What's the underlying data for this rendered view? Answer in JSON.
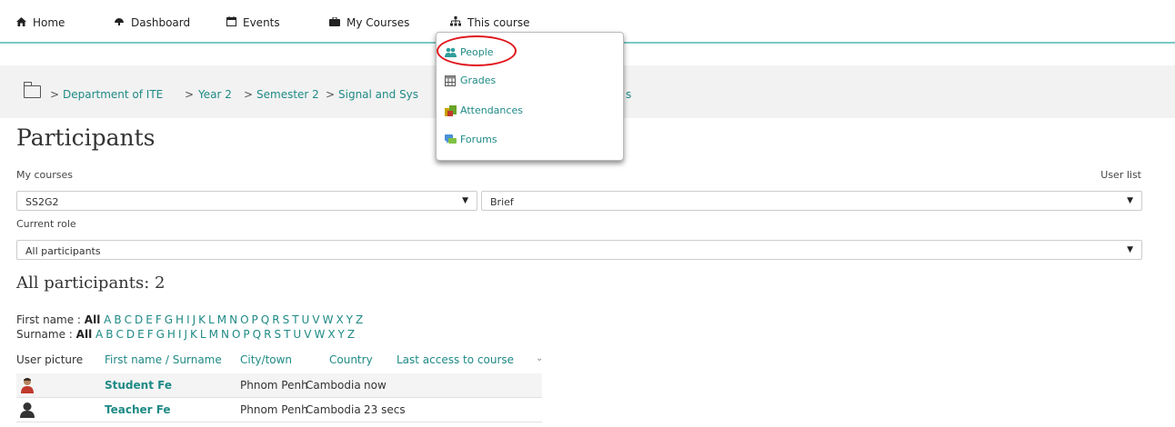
{
  "nav": {
    "items": [
      {
        "label": "Home",
        "icon": "home-icon"
      },
      {
        "label": "Dashboard",
        "icon": "dashboard-icon"
      },
      {
        "label": "Events",
        "icon": "calendar-icon"
      },
      {
        "label": "My Courses",
        "icon": "briefcase-icon"
      },
      {
        "label": "This course",
        "icon": "sitemap-icon"
      }
    ]
  },
  "breadcrumb": {
    "separator": ">",
    "items": [
      "Department of ITE",
      "Year 2",
      "Semester 2",
      "Signal and Sys"
    ],
    "trailing": "s"
  },
  "dropdown": {
    "items": [
      {
        "label": "People",
        "icon": "people-icon"
      },
      {
        "label": "Grades",
        "icon": "grades-icon"
      },
      {
        "label": "Attendances",
        "icon": "attendances-icon"
      },
      {
        "label": "Forums",
        "icon": "forums-icon"
      }
    ],
    "highlighted": "People"
  },
  "page": {
    "title": "Participants",
    "my_courses_label": "My courses",
    "user_list_label": "User list",
    "course_select_value": "SS2G2",
    "user_list_select_value": "Brief",
    "current_role_label": "Current role",
    "role_select_value": "All participants",
    "all_participants_heading": "All participants: 2"
  },
  "filters": {
    "first_name_label": "First name :",
    "surname_label": "Surname :",
    "all_label": "All",
    "letters": [
      "A",
      "B",
      "C",
      "D",
      "E",
      "F",
      "G",
      "H",
      "I",
      "J",
      "K",
      "L",
      "M",
      "N",
      "O",
      "P",
      "Q",
      "R",
      "S",
      "T",
      "U",
      "V",
      "W",
      "X",
      "Y",
      "Z"
    ]
  },
  "table": {
    "headers": [
      "User picture",
      "First name / Surname",
      "City/town",
      "Country",
      "Last access to course"
    ],
    "sort_indicator": "⌄",
    "rows": [
      {
        "name": "Student Fe",
        "city": "Phnom Penh",
        "country": "Cambodia",
        "last_access": "now",
        "avatar": "student-avatar"
      },
      {
        "name": "Teacher Fe",
        "city": "Phnom Penh",
        "country": "Cambodia",
        "last_access": "23 secs",
        "avatar": "default-avatar"
      }
    ]
  },
  "colors": {
    "link": "#1f8a86",
    "nav_border": "#7bc8c5",
    "highlight_circle": "#e0141b",
    "breadcrumb_bg": "#f2f2f2"
  }
}
